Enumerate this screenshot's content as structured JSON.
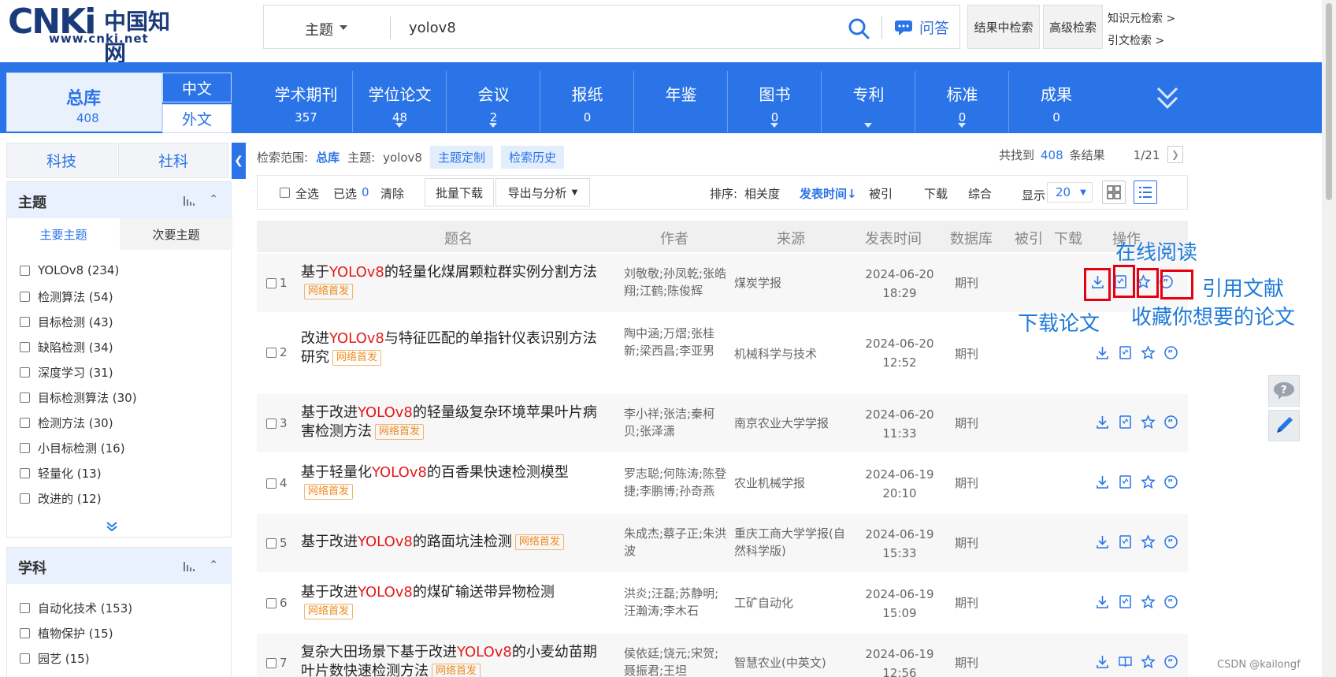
{
  "header": {
    "logo_cnki": "CNKi",
    "logo_cn": "中国知网",
    "logo_url": "www.cnki.net",
    "field_select": "主题",
    "query": "yolov8",
    "qa_label": "问答",
    "btn_in_results": "结果中检索",
    "btn_advanced": "高级检索",
    "link_knowledge": "知识元检索 >",
    "link_citation": "引文检索 >"
  },
  "nav": {
    "total_label": "总库",
    "total_count": "408",
    "lang_zh": "中文",
    "lang_en": "外文",
    "tabs": [
      {
        "label": "学术期刊",
        "count": "357"
      },
      {
        "label": "学位论文",
        "count": "48"
      },
      {
        "label": "会议",
        "count": "2"
      },
      {
        "label": "报纸",
        "count": "0"
      },
      {
        "label": "年鉴",
        "count": ""
      },
      {
        "label": "图书",
        "count": "0"
      },
      {
        "label": "专利",
        "count": ""
      },
      {
        "label": "标准",
        "count": "0"
      },
      {
        "label": "成果",
        "count": "0"
      }
    ]
  },
  "sidebar": {
    "cat_tabs": [
      "科技",
      "社科"
    ],
    "topic_panel": {
      "title": "主题",
      "subtabs": [
        "主要主题",
        "次要主题"
      ],
      "items": [
        "YOLOv8 (234)",
        "检测算法 (54)",
        "目标检测 (43)",
        "缺陷检测 (34)",
        "深度学习 (31)",
        "目标检测算法 (30)",
        "检测方法 (30)",
        "小目标检测 (16)",
        "轻量化 (13)",
        "改进的 (12)"
      ]
    },
    "subject_panel": {
      "title": "学科",
      "items": [
        "自动化技术 (153)",
        "植物保护 (15)",
        "园艺 (15)"
      ]
    }
  },
  "results": {
    "scope_label": "检索范围:",
    "scope_value": "总库",
    "topic_label": "主题:",
    "topic_value": "yolov8",
    "chip_custom": "主题定制",
    "chip_history": "检索历史",
    "found_pre": "共找到",
    "found_count": "408",
    "found_post": "条结果",
    "page": "1/21",
    "toolbar": {
      "select_all": "全选",
      "selected_label": "已选",
      "selected_count": "0",
      "clear": "清除",
      "batch_download": "批量下载",
      "export": "导出与分析",
      "sort_label": "排序:",
      "sort_relevance": "相关度",
      "sort_date": "发表时间",
      "sort_cited": "被引",
      "sort_download": "下载",
      "sort_composite": "综合",
      "display_label": "显示",
      "page_size": "20"
    },
    "columns": [
      "题名",
      "作者",
      "来源",
      "发表时间",
      "数据库",
      "被引",
      "下载",
      "操作"
    ],
    "rows": [
      {
        "no": "1",
        "pre": "基于",
        "kw": "YOLOv8",
        "post": "的轻量化煤屑颗粒群实例分割方法",
        "badge": "网络首发",
        "authors": "刘敬敬;孙凤乾;张皓翔;江鹤;陈俊辉",
        "source": "煤炭学报",
        "date": "2024-06-20",
        "time": "18:29",
        "db": "期刊"
      },
      {
        "no": "2",
        "pre": "改进",
        "kw": "YOLOv8",
        "post": "与特征匹配的单指针仪表识别方法研究",
        "badge": "网络首发",
        "authors": "陶中涵;万熠;张桂新;梁西昌;李亚男",
        "source": "机械科学与技术",
        "date": "2024-06-20",
        "time": "12:52",
        "db": "期刊"
      },
      {
        "no": "3",
        "pre": "基于改进",
        "kw": "YOLOv8",
        "post": "的轻量级复杂环境苹果叶片病害检测方法",
        "badge": "网络首发",
        "authors": "李小祥;张洁;秦柯贝;张泽潇",
        "source": "南京农业大学学报",
        "date": "2024-06-20",
        "time": "11:33",
        "db": "期刊"
      },
      {
        "no": "4",
        "pre": "基于轻量化",
        "kw": "YOLOv8",
        "post": "的百香果快速检测模型",
        "badge": "网络首发",
        "authors": "罗志聪;何陈涛;陈登捷;李鹏博;孙奇燕",
        "source": "农业机械学报",
        "date": "2024-06-19",
        "time": "20:10",
        "db": "期刊"
      },
      {
        "no": "5",
        "pre": "基于改进",
        "kw": "YOLOv8",
        "post": "的路面坑洼检测",
        "badge": "网络首发",
        "authors": "朱成杰;蔡子正;朱洪波",
        "source": "重庆工商大学学报(自然科学版)",
        "date": "2024-06-19",
        "time": "15:33",
        "db": "期刊"
      },
      {
        "no": "6",
        "pre": "基于改进",
        "kw": "YOLOv8",
        "post": "的煤矿输送带异物检测",
        "badge": "网络首发",
        "authors": "洪炎;汪磊;苏静明;汪瀚涛;李木石",
        "source": "工矿自动化",
        "date": "2024-06-19",
        "time": "15:09",
        "db": "期刊"
      },
      {
        "no": "7",
        "pre": "复杂大田场景下基于改进",
        "kw": "YOLOv8",
        "post": "的小麦幼苗期叶片数快速检测方法",
        "badge": "网络首发",
        "authors": "侯依廷;饶元;宋贺;聂振君;王坦",
        "source": "智慧农业(中英文)",
        "date": "2024-06-19",
        "time": "12:56",
        "db": "期刊"
      }
    ]
  },
  "annotations": {
    "online_read": "在线阅读",
    "cite": "引用文献",
    "download_paper": "下载论文",
    "collect": "收藏你想要的论文"
  },
  "watermark": "CSDN @kailongf",
  "colors": {
    "brand_blue": "#2a74e8",
    "keyword_red": "#e31b1b",
    "badge_orange": "#f08b1e",
    "annotation_blue": "#1e7bd8",
    "annotation_box_red": "#e60012"
  }
}
